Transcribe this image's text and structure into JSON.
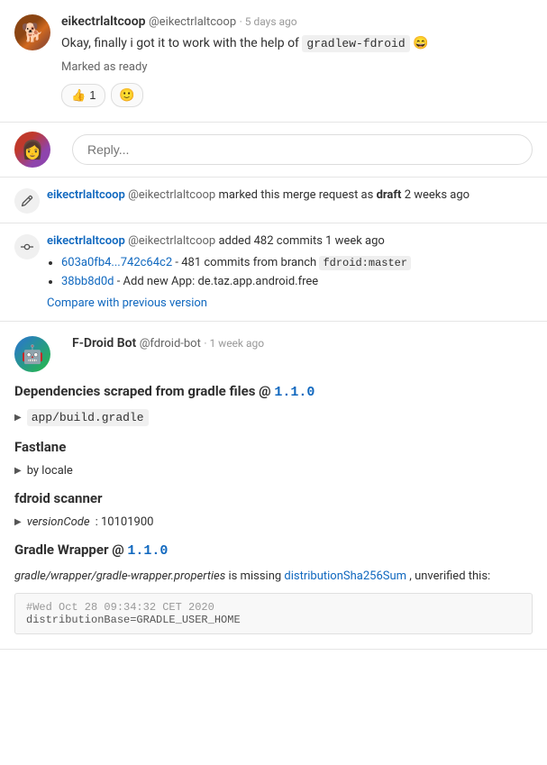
{
  "comments": [
    {
      "id": "comment-1",
      "username": "eikectrlaltcoop",
      "handle": "@eikectrlaltcoop",
      "timestamp": "5 days ago",
      "body_prefix": "Okay, finally i got it to work with the help of ",
      "body_code": "gradlew-fdroid",
      "body_emoji": "😄",
      "marked_ready": "Marked as ready",
      "reaction_count": "1",
      "reaction_emoji": "👍"
    }
  ],
  "reply": {
    "placeholder": "Reply..."
  },
  "activities": [
    {
      "id": "activity-edit",
      "icon": "edit",
      "text_parts": [
        {
          "type": "bold-link",
          "text": "eikectrlaltcoop"
        },
        {
          "type": "normal",
          "text": " "
        },
        {
          "type": "handle",
          "text": "@eikectrlaltcoop"
        },
        {
          "type": "normal",
          "text": " marked this merge request as "
        },
        {
          "type": "bold",
          "text": "draft"
        },
        {
          "type": "normal",
          "text": " 2 weeks ago"
        }
      ]
    },
    {
      "id": "activity-commits",
      "icon": "commit",
      "text_parts": [
        {
          "type": "bold-link",
          "text": "eikectrlaltcoop"
        },
        {
          "type": "normal",
          "text": " "
        },
        {
          "type": "handle",
          "text": "@eikectrlaltcoop"
        },
        {
          "type": "normal",
          "text": " added 482 commits 1 week ago"
        }
      ],
      "commits": [
        {
          "hash_link": "603a0fb4...742c64c2",
          "description": " - 481 commits from branch ",
          "branch_code": "fdroid:master"
        },
        {
          "hash_link": "38bb8d0d",
          "description": " - Add new App: de.taz.app.android.free"
        }
      ],
      "compare_link": "Compare with previous version"
    }
  ],
  "bot_comment": {
    "username": "F-Droid Bot",
    "handle": "@fdroid-bot",
    "timestamp": "1 week ago",
    "title_prefix": "Dependencies scraped from gradle files @ ",
    "title_version": "1.1.0",
    "sections": [
      {
        "id": "app-build-gradle",
        "heading": null,
        "collapsible": true,
        "collapsible_label": "app/build.gradle"
      },
      {
        "id": "fastlane",
        "heading": "Fastlane",
        "collapsible": true,
        "collapsible_label": "by locale"
      },
      {
        "id": "fdroid-scanner",
        "heading": "fdroid scanner",
        "collapsible": true,
        "collapsible_label": "versionCode",
        "collapsible_code_value": ": 10101900"
      },
      {
        "id": "gradle-wrapper",
        "heading_prefix": "Gradle Wrapper @ ",
        "heading_version": "1.1.0",
        "missing_text_prefix": "gradle/wrapper/gradle-wrapper.properties",
        "missing_text_middle": " is missing ",
        "missing_link": "distributionSha256Sum",
        "missing_text_suffix": ", unverified this:",
        "code_lines": [
          "#Wed Oct 28 09:34:32 CET 2020",
          "distributionBase=GRADLE_USER_HOME"
        ]
      }
    ]
  },
  "labels": {
    "reply_placeholder": "Reply...",
    "marked_as_draft": "draft",
    "compare_link": "Compare with previous version"
  }
}
